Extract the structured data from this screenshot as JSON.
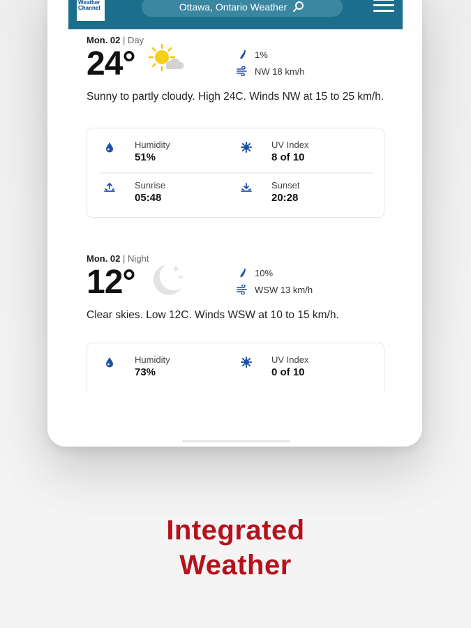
{
  "header": {
    "logo_text": "The\nWeather\nChannel",
    "search_label": "Ottawa, Ontario Weather"
  },
  "day": {
    "date": "Mon. 02",
    "separator": "|",
    "period": "Day",
    "temperature": "24°",
    "condition_icon": "sun-partly-cloudy-icon",
    "precip": "1%",
    "wind": "NW 18 km/h",
    "description": "Sunny to partly cloudy. High 24C. Winds NW at 15 to 25 km/h.",
    "details": {
      "humidity_label": "Humidity",
      "humidity_value": "51%",
      "uv_label": "UV Index",
      "uv_value": "8 of 10",
      "sunrise_label": "Sunrise",
      "sunrise_value": "05:48",
      "sunset_label": "Sunset",
      "sunset_value": "20:28"
    }
  },
  "night": {
    "date": "Mon. 02",
    "separator": "|",
    "period": "Night",
    "temperature": "12°",
    "condition_icon": "moon-stars-icon",
    "precip": "10%",
    "wind": "WSW 13 km/h",
    "description": "Clear skies. Low 12C. Winds WSW at 10 to 15 km/h.",
    "details": {
      "humidity_label": "Humidity",
      "humidity_value": "73%",
      "uv_label": "UV Index",
      "uv_value": "0 of 10"
    }
  },
  "tagline": {
    "line1": "Integrated",
    "line2": "Weather"
  },
  "colors": {
    "header_bg": "#1b6f8c",
    "accent_blue": "#1e4fa8",
    "tagline_red": "#b5121b"
  }
}
